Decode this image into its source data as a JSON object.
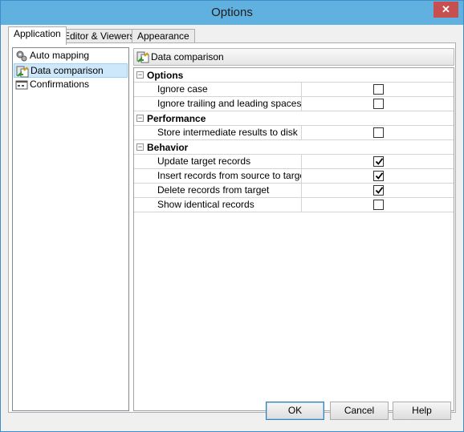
{
  "window": {
    "title": "Options",
    "close_glyph": "✕"
  },
  "tabs": [
    {
      "label": "Application",
      "active": true
    },
    {
      "label": "Editor & Viewers",
      "active": false
    },
    {
      "label": "Appearance",
      "active": false
    }
  ],
  "nav": {
    "items": [
      {
        "label": "Auto mapping",
        "icon": "auto-mapping-icon",
        "selected": false
      },
      {
        "label": "Data comparison",
        "icon": "data-comparison-icon",
        "selected": true
      },
      {
        "label": "Confirmations",
        "icon": "confirmations-icon",
        "selected": false
      }
    ]
  },
  "section": {
    "title": "Data comparison"
  },
  "grid": {
    "categories": [
      {
        "label": "Options",
        "toggle": "⊟",
        "properties": [
          {
            "label": "Ignore case",
            "checked": false
          },
          {
            "label": "Ignore trailing and leading spaces",
            "checked": false
          }
        ]
      },
      {
        "label": "Performance",
        "toggle": "⊟",
        "properties": [
          {
            "label": "Store intermediate results to disk",
            "checked": false
          }
        ]
      },
      {
        "label": "Behavior",
        "toggle": "⊟",
        "properties": [
          {
            "label": "Update target records",
            "checked": true
          },
          {
            "label": "Insert records from source to target",
            "checked": true
          },
          {
            "label": "Delete records from target",
            "checked": true
          },
          {
            "label": "Show identical records",
            "checked": false
          }
        ]
      }
    ]
  },
  "buttons": {
    "ok": "OK",
    "cancel": "Cancel",
    "help": "Help"
  },
  "colors": {
    "titlebar": "#60b0e0",
    "selection": "#cde8fb",
    "close": "#c74f4f"
  }
}
